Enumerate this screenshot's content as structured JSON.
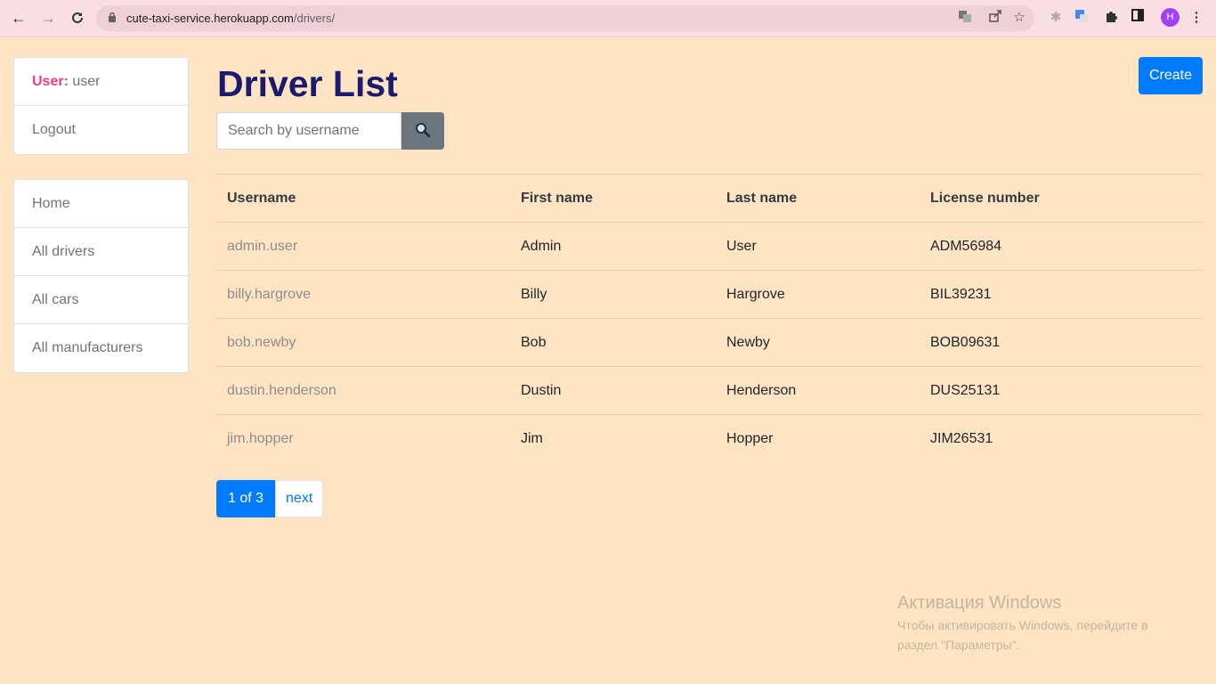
{
  "browser": {
    "url_host": "cute-taxi-service.herokuapp.com",
    "url_path": "/drivers/",
    "profile_initial": "H"
  },
  "sidebar": {
    "user_label": "User:",
    "user_name": "user",
    "logout": "Logout",
    "nav": [
      "Home",
      "All drivers",
      "All cars",
      "All manufacturers"
    ]
  },
  "main": {
    "title": "Driver List",
    "create_label": "Create",
    "search_placeholder": "Search by username",
    "columns": [
      "Username",
      "First name",
      "Last name",
      "License number"
    ],
    "rows": [
      [
        "admin.user",
        "Admin",
        "User",
        "ADM56984"
      ],
      [
        "billy.hargrove",
        "Billy",
        "Hargrove",
        "BIL39231"
      ],
      [
        "bob.newby",
        "Bob",
        "Newby",
        "BOB09631"
      ],
      [
        "dustin.henderson",
        "Dustin",
        "Henderson",
        "DUS25131"
      ],
      [
        "jim.hopper",
        "Jim",
        "Hopper",
        "JIM26531"
      ]
    ],
    "pagination": {
      "current": "1 of 3",
      "next": "next"
    }
  },
  "watermark": {
    "line1": "Активация Windows",
    "line2": "Чтобы активировать Windows, перейдите в",
    "line3": "раздел \"Параметры\"."
  },
  "colors": {
    "page_bg": "#ffe4c4",
    "accent": "#007bff",
    "title": "#1a1a6e",
    "user_label": "#e83e8c"
  }
}
